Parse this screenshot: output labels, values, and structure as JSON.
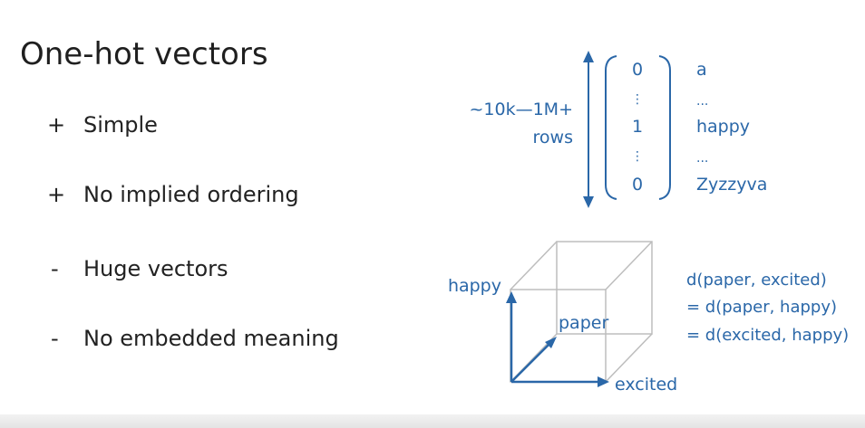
{
  "title": "One-hot vectors",
  "bullets": [
    {
      "sign": "+",
      "text": "Simple"
    },
    {
      "sign": "+",
      "text": "No implied ordering"
    },
    {
      "sign": "-",
      "text": "Huge vectors"
    },
    {
      "sign": "-",
      "text": "No embedded meaning"
    }
  ],
  "vector": {
    "size_label_line1": "~10k—1M+",
    "size_label_line2": "rows",
    "entries": [
      "0",
      "⋮",
      "1",
      "⋮",
      "0"
    ],
    "words": [
      "a",
      "...",
      "happy",
      "...",
      "Zyzzyva"
    ]
  },
  "cube": {
    "axis_up": "happy",
    "axis_diag": "paper",
    "axis_right": "excited"
  },
  "distances": [
    "d(paper, excited)",
    "= d(paper, happy)",
    "= d(excited, happy)"
  ],
  "colors": {
    "accent": "#2a67a8",
    "cube_line": "#bdbdbd",
    "text": "#222222"
  }
}
